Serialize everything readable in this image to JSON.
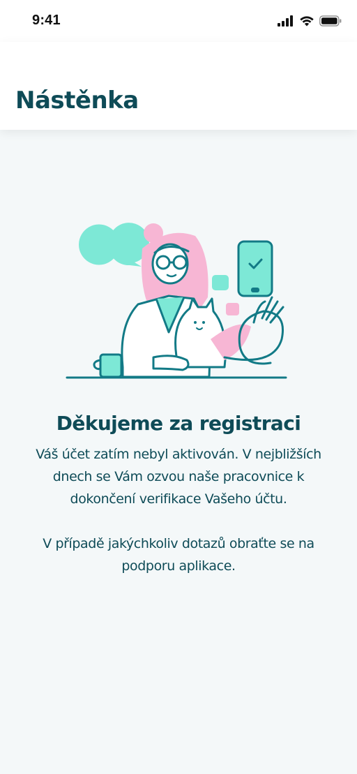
{
  "status_bar": {
    "time": "9:41",
    "icons": [
      "signal-icon",
      "wifi-icon",
      "battery-icon"
    ]
  },
  "header": {
    "title": "Nástěnka"
  },
  "main": {
    "illustration": "doctor-with-cat-and-phone-illustration",
    "headline": "Děkujeme za registraci",
    "message": "Váš účet zatím nebyl aktivován. V nejbližších dnech se Vám ozvou naše pracovnice k dokončení verifikace Vašeho účtu.",
    "support_message": "V případě jakýchkoliv dotazů obraťte se na podporu aplikace."
  },
  "colors": {
    "primary_text": "#0e4b57",
    "accent_mint": "#7de8d6",
    "accent_pink": "#f7b6d4",
    "background": "#f4f8f9"
  }
}
